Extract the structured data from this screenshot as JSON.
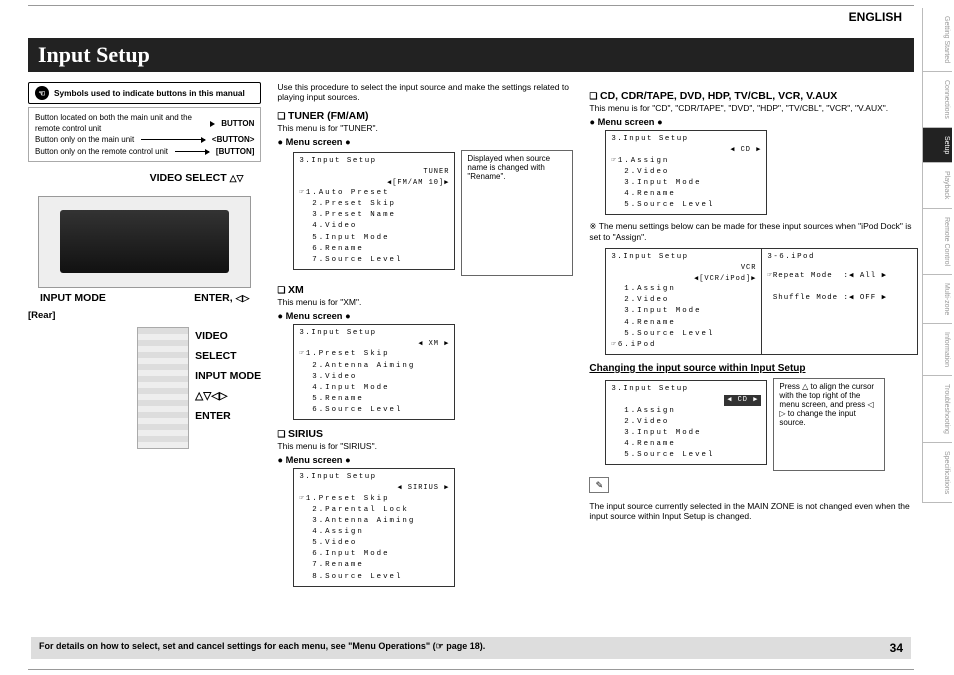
{
  "header": {
    "lang": "ENGLISH",
    "title": "Input Setup",
    "page_num": "34"
  },
  "footer": {
    "text": "For details on how to select, set and cancel settings for each menu, see \"Menu Operations\" (☞ page 18)."
  },
  "tabs": [
    "Getting Started",
    "Connections",
    "Setup",
    "Playback",
    "Remote Control",
    "Multi-zone",
    "Information",
    "Troubleshooting",
    "Specifications"
  ],
  "symbols": {
    "heading": "Symbols used to indicate buttons in this manual",
    "r1a": "Button located on both the main unit and the remote control unit",
    "r1b": "BUTTON",
    "r2a": "Button only on the main unit",
    "r2b": "<BUTTON>",
    "r3a": "Button only on the remote control unit",
    "r3b": "[BUTTON]"
  },
  "device": {
    "video_select": "VIDEO SELECT",
    "input_mode": "INPUT MODE",
    "enter": "ENTER,",
    "rear": "[Rear]",
    "r_video_select": "VIDEO SELECT",
    "r_input_mode": "INPUT MODE",
    "r_nav": "△▽◁▷",
    "r_enter": "ENTER",
    "tri_ud": "△▽",
    "tri_lr": "◁▷"
  },
  "intro": "Use this procedure to select the input source and make the settings related to playing input sources.",
  "tuner": {
    "h": "TUNER (FM/AM)",
    "desc": "This menu is for \"TUNER\".",
    "menu": "Menu screen",
    "box_title": "3.Input Setup",
    "box_src": "TUNER\n◀[FM/AM 10]▶",
    "items": "☞1.Auto Preset\n  2.Preset Skip\n  3.Preset Name\n  4.Video\n  5.Input Mode\n  6.Rename\n  7.Source Level",
    "callout": "Displayed when source name is changed with \"Rename\"."
  },
  "xm": {
    "h": "XM",
    "desc": "This menu is for \"XM\".",
    "menu": "Menu screen",
    "box_title": "3.Input Setup",
    "box_src": "◀    XM    ▶",
    "items": "☞1.Preset Skip\n  2.Antenna Aiming\n  3.Video\n  4.Input Mode\n  5.Rename\n  6.Source Level"
  },
  "sirius": {
    "h": "SIRIUS",
    "desc": "This menu is for \"SIRIUS\".",
    "menu": "Menu screen",
    "box_title": "3.Input Setup",
    "box_src": "◀  SIRIUS  ▶",
    "items": "☞1.Preset Skip\n  2.Parental Lock\n  3.Antenna Aiming\n  4.Assign\n  5.Video\n  6.Input Mode\n  7.Rename\n  8.Source Level"
  },
  "cd": {
    "h": "CD, CDR/TAPE, DVD, HDP, TV/CBL, VCR, V.AUX",
    "desc": "This menu is for \"CD\", \"CDR/TAPE\", \"DVD\", \"HDP\", \"TV/CBL\", \"VCR\", \"V.AUX\".",
    "menu": "Menu screen",
    "box_title": "3.Input Setup",
    "box_src": "◀    CD    ▶",
    "items": "☞1.Assign\n  2.Video\n  3.Input Mode\n  4.Rename\n  5.Source Level",
    "note": "The menu settings below can be made for these input sources when \"iPod Dock\" is set to \"Assign\".",
    "box2_title": "3.Input Setup",
    "box2_src": "VCR\n◀[VCR/iPod]▶",
    "box2_items": "  1.Assign\n  2.Video\n  3.Input Mode\n  4.Rename\n  5.Source Level\n☞6.iPod",
    "box3_title": "3-6.iPod",
    "box3_items": "☞Repeat Mode  :◀ All ▶\n\n Shuffle Mode :◀ OFF ▶"
  },
  "change": {
    "h": "Changing the input source within Input Setup",
    "box_title": "3.Input Setup",
    "box_src": "◀    CD    ▶",
    "items": "  1.Assign\n  2.Video\n  3.Input Mode\n  4.Rename\n  5.Source Level",
    "callout": "Press △ to align the cursor with the top right of the menu screen, and press ◁ ▷ to change the input source.",
    "note": "The input source currently selected in the MAIN ZONE is not changed even when the input source within Input Setup is changed."
  }
}
